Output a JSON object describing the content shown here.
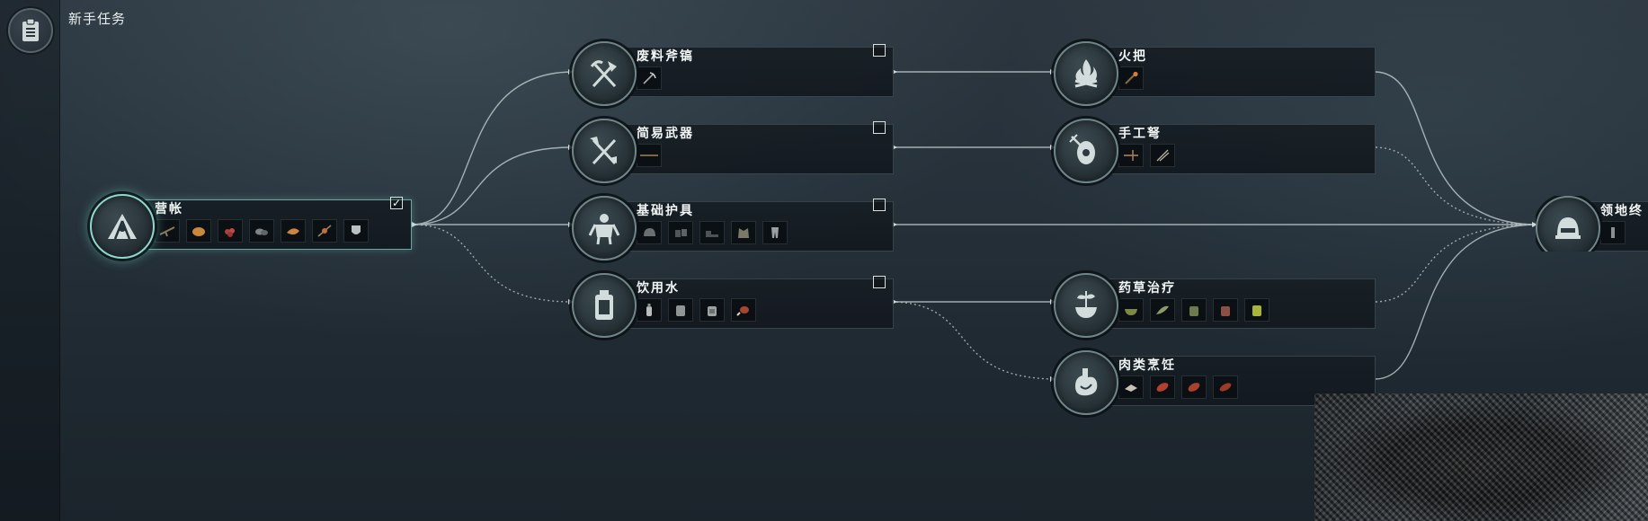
{
  "app": {
    "title": "新手任务",
    "quest_log_icon": "clipboard-icon"
  },
  "quests": {
    "camp": {
      "title": "营帐",
      "completed": true,
      "check_glyph": "✓",
      "emblem_icon": "camp-tent-icon",
      "items": [
        "branch-item-icon",
        "bread-item-icon",
        "berries-item-icon",
        "stone-item-icon",
        "meat-item-icon",
        "skewer-item-icon",
        "shield-item-icon"
      ]
    },
    "scrap_axe": {
      "title": "废料斧镐",
      "completed": false,
      "emblem_icon": "axe-pickaxe-icon",
      "items": [
        "pickaxe-item-icon"
      ]
    },
    "simple_weapon": {
      "title": "简易武器",
      "completed": false,
      "emblem_icon": "crossed-weapons-icon",
      "items": [
        "spear-item-icon"
      ]
    },
    "basic_armor": {
      "title": "基础护具",
      "completed": false,
      "emblem_icon": "armored-figure-icon",
      "items": [
        "helmet-item-icon",
        "gloves-item-icon",
        "boots-item-icon",
        "vest-item-icon",
        "leggings-item-icon"
      ]
    },
    "drinking_water": {
      "title": "饮用水",
      "completed": false,
      "emblem_icon": "water-canister-icon",
      "items": [
        "bottle-item-icon",
        "canteen-item-icon",
        "jug-item-icon",
        "meat-leg-item-icon"
      ]
    },
    "torch": {
      "title": "火把",
      "completed": false,
      "emblem_icon": "campfire-icon",
      "items": [
        "torch-item-icon"
      ]
    },
    "handmade_crossbow": {
      "title": "手工弩",
      "completed": false,
      "emblem_icon": "crossbow-target-icon",
      "items": [
        "crossbow-item-icon",
        "bolts-item-icon"
      ]
    },
    "herbal_treatment": {
      "title": "药草治疗",
      "completed": false,
      "emblem_icon": "herb-mortar-icon",
      "items": [
        "mortar-item-icon",
        "herb-item-icon",
        "jar-item-icon",
        "pouch-item-icon",
        "tonic-item-icon"
      ]
    },
    "meat_cooking": {
      "title": "肉类烹饪",
      "completed": false,
      "emblem_icon": "stomach-icon",
      "items": [
        "raw-meat-item-icon",
        "steak-item-icon",
        "fillet-item-icon",
        "jerky-item-icon"
      ]
    },
    "territory": {
      "title": "领地终",
      "completed": false,
      "emblem_icon": "helmet-icon",
      "items": [
        "totem-item-icon"
      ]
    }
  },
  "colors": {
    "accent_active": "#8fd6cc",
    "link_line": "#b8c4c6",
    "card_bg": "#161e24"
  }
}
